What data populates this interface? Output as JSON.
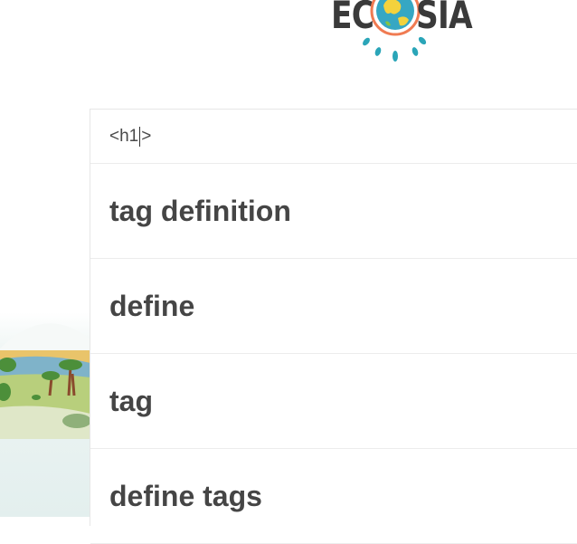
{
  "logo": {
    "left_text": "EC",
    "right_text": "SIA",
    "alt": "Ecosia"
  },
  "search": {
    "value_before_caret": "<h1",
    "value_after_caret": ">"
  },
  "suggestions": [
    {
      "label": "tag definition"
    },
    {
      "label": "define"
    },
    {
      "label": "tag"
    },
    {
      "label": "define tags"
    }
  ],
  "colors": {
    "logo_text": "#3a3a3a",
    "globe_ring": "#f07b52",
    "globe_water": "#36a7c3",
    "globe_land": "#f3d23c",
    "leaf": "#2aa5b8",
    "suggestion_text": "#454545"
  }
}
